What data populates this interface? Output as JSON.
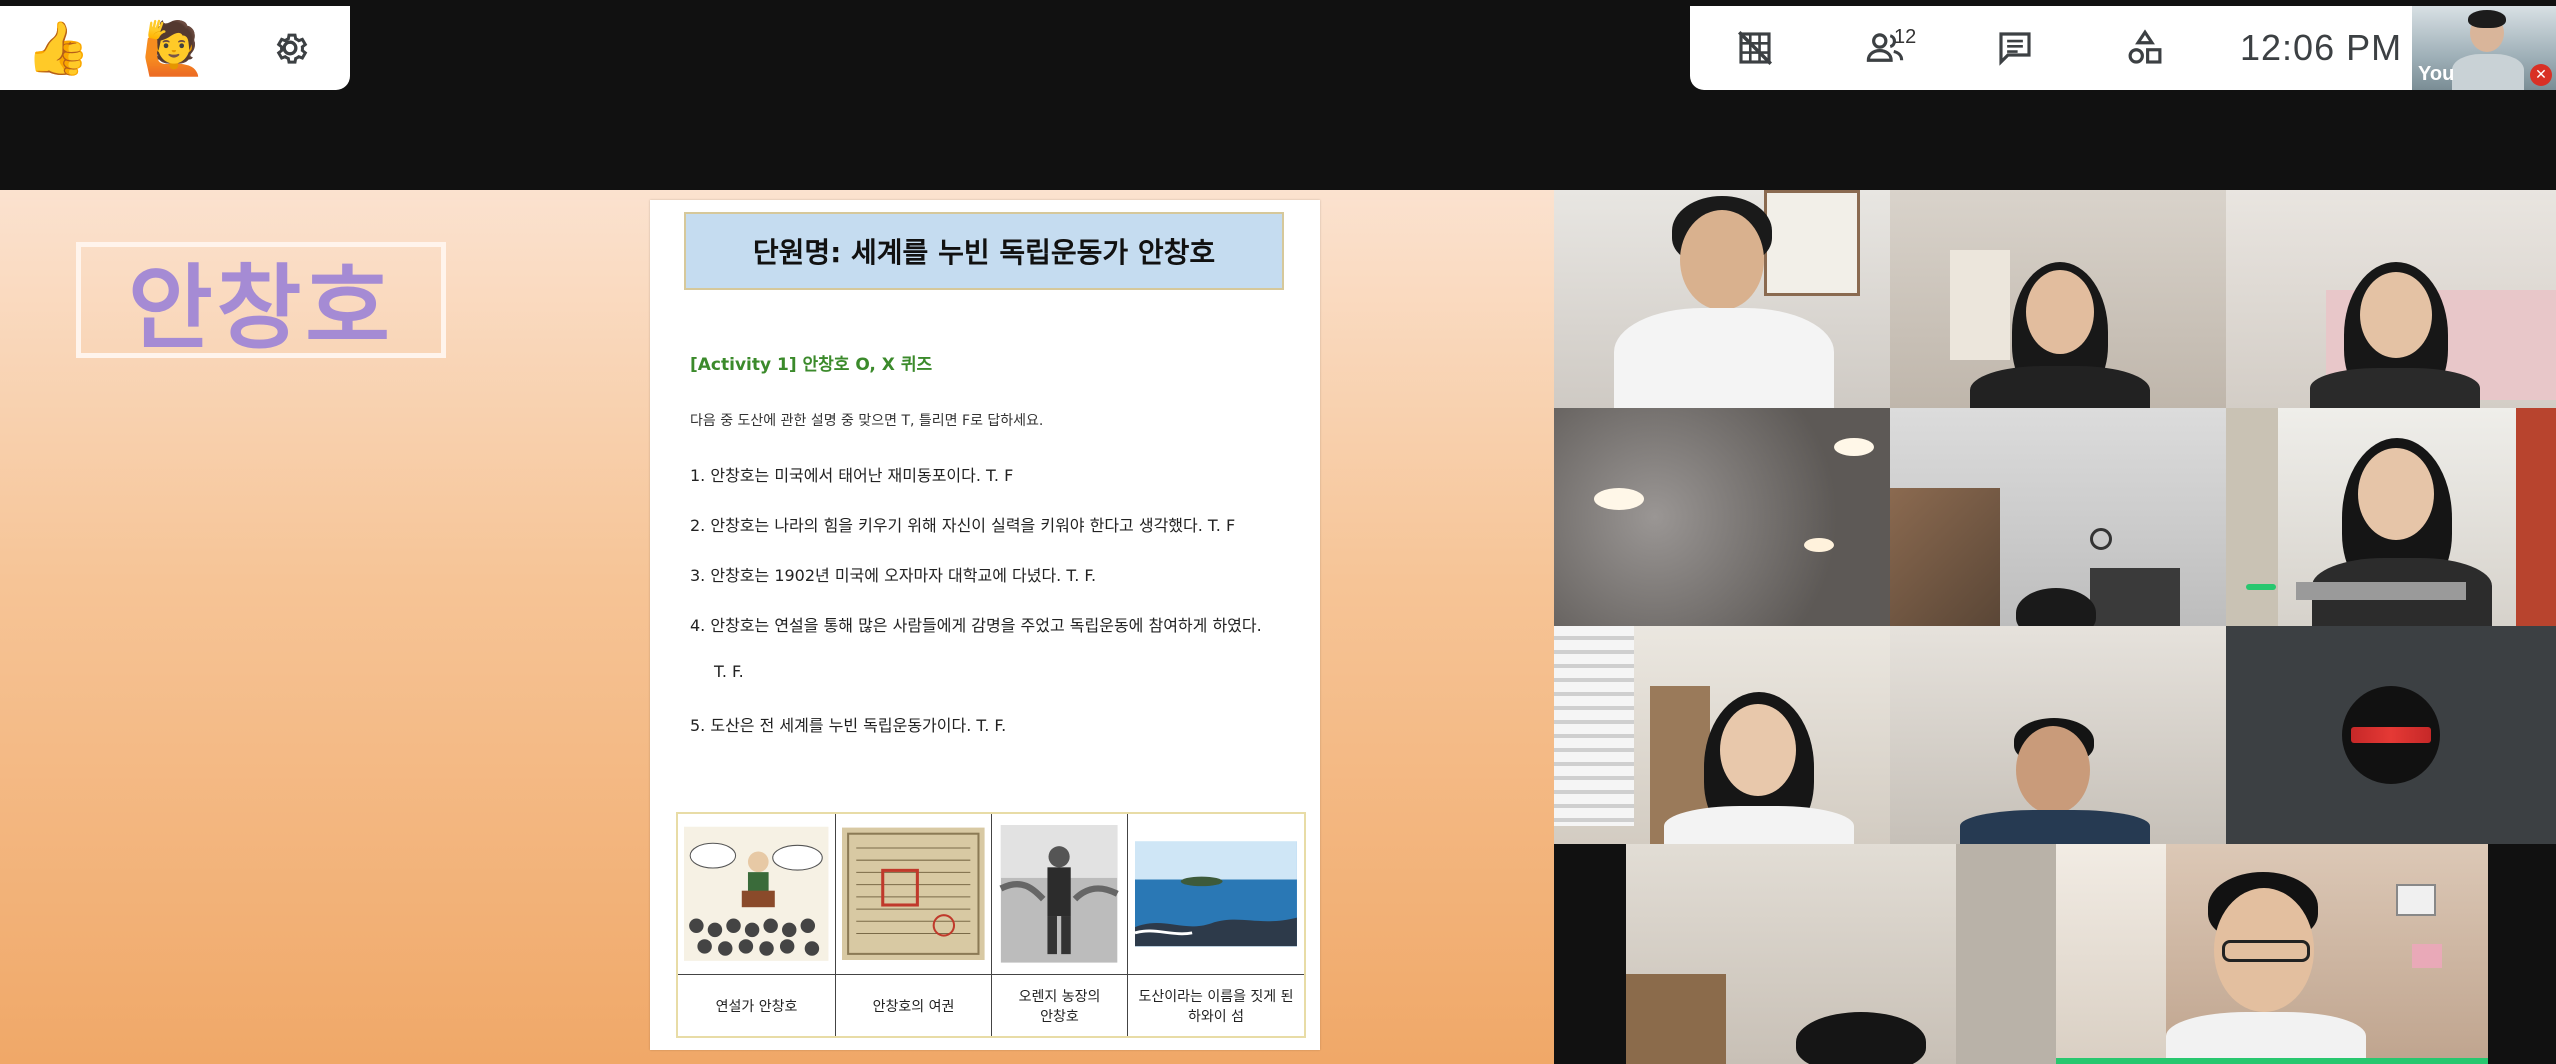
{
  "reactions": {
    "thumbs_up": "👍",
    "raise_hand": "🙋"
  },
  "toolbar": {
    "participants_count": "12",
    "clock": "12:06 PM"
  },
  "self_view": {
    "label": "You"
  },
  "slide": {
    "name_title": "안창호",
    "doc_title": "단원명: 세계를 누빈 독립운동가 안창호",
    "activity": "[Activity 1] 안창호 O, X 퀴즈",
    "instruction": "다음 중 도산에 관한 설명 중 맞으면 T, 틀리면 F로 답하세요.",
    "questions": [
      "1. 안창호는 미국에서 태어난 재미동포이다.   T.  F",
      "2. 안창호는 나라의 힘을 키우기 위해 자신이 실력을 키워야 한다고 생각했다.  T.  F",
      "3. 안창호는 1902년 미국에 오자마자 대학교에 다녔다.  T.  F.",
      "4. 안창호는 연설을 통해 많은 사람들에게 감명을 주었고 독립운동에 참여하게 하였다.",
      "T.  F.",
      "5. 도산은 전 세계를 누빈 독립운동가이다. T.  F."
    ],
    "captions": [
      "연설가 안창호",
      "안창호의 여권",
      "오렌지 농장의\n안창호",
      "도산이라는 이름을 짓게 된\n하와이 섬"
    ]
  },
  "colors": {
    "accent_purple": "#a58bd4",
    "activity_green": "#3b8a2b",
    "title_blue": "#c5dcf0",
    "mute_red": "#d93025"
  },
  "icons": {
    "settings": "gear-icon",
    "captions_off": "grid-off-icon",
    "participants": "people-icon",
    "chat": "chat-icon",
    "activities": "shapes-icon"
  }
}
